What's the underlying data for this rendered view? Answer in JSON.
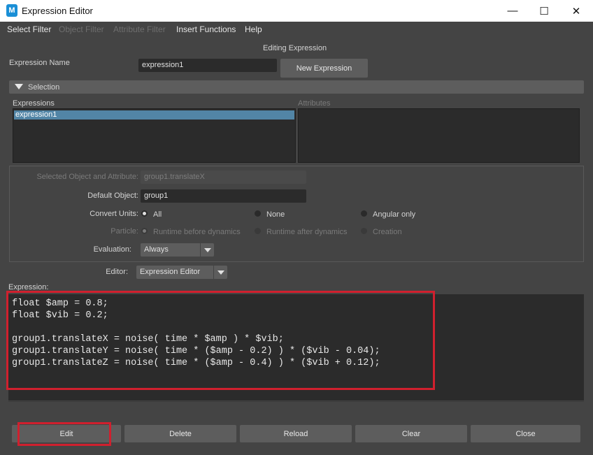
{
  "window": {
    "title": "Expression Editor",
    "app_icon": "M",
    "minimize": "—",
    "maximize": "☐",
    "close": "✕"
  },
  "menu": [
    {
      "label": "Select Filter",
      "enabled": true
    },
    {
      "label": "Object Filter",
      "enabled": false
    },
    {
      "label": "Attribute Filter",
      "enabled": false
    },
    {
      "label": "Insert Functions",
      "enabled": true
    },
    {
      "label": "Help",
      "enabled": true
    }
  ],
  "header": {
    "editing_label": "Editing Expression",
    "expression_name_label": "Expression Name",
    "expression_name_value": "expression1",
    "new_expression_button": "New Expression"
  },
  "selection": {
    "title": "Selection",
    "expressions_label": "Expressions",
    "attributes_label": "Attributes",
    "expressions": [
      "expression1"
    ]
  },
  "options": {
    "selected_obj_attr_label": "Selected Object and Attribute:",
    "selected_obj_attr_value": "group1.translateX",
    "default_object_label": "Default Object:",
    "default_object_value": "group1",
    "convert_units_label": "Convert Units:",
    "convert_units": [
      "All",
      "None",
      "Angular only"
    ],
    "convert_units_selected": "All",
    "particle_label": "Particle:",
    "particle": [
      "Runtime before dynamics",
      "Runtime after dynamics",
      "Creation"
    ],
    "particle_selected": "Runtime before dynamics",
    "evaluation_label": "Evaluation:",
    "evaluation_value": "Always",
    "editor_label": "Editor:",
    "editor_value": "Expression Editor"
  },
  "expression": {
    "label": "Expression:",
    "lines": [
      "float $amp = 0.8;",
      "float $vib = 0.2;",
      "",
      "group1.translateX = noise( time * $amp ) * $vib;",
      "group1.translateY = noise( time * ($amp - 0.2) ) * ($vib - 0.04);",
      "group1.translateZ = noise( time * ($amp - 0.4) ) * ($vib + 0.12);"
    ]
  },
  "buttons": {
    "edit": "Edit",
    "delete": "Delete",
    "reload": "Reload",
    "clear": "Clear",
    "close": "Close"
  },
  "colors": {
    "highlight": "#d0202e",
    "selection": "#5285a6"
  }
}
